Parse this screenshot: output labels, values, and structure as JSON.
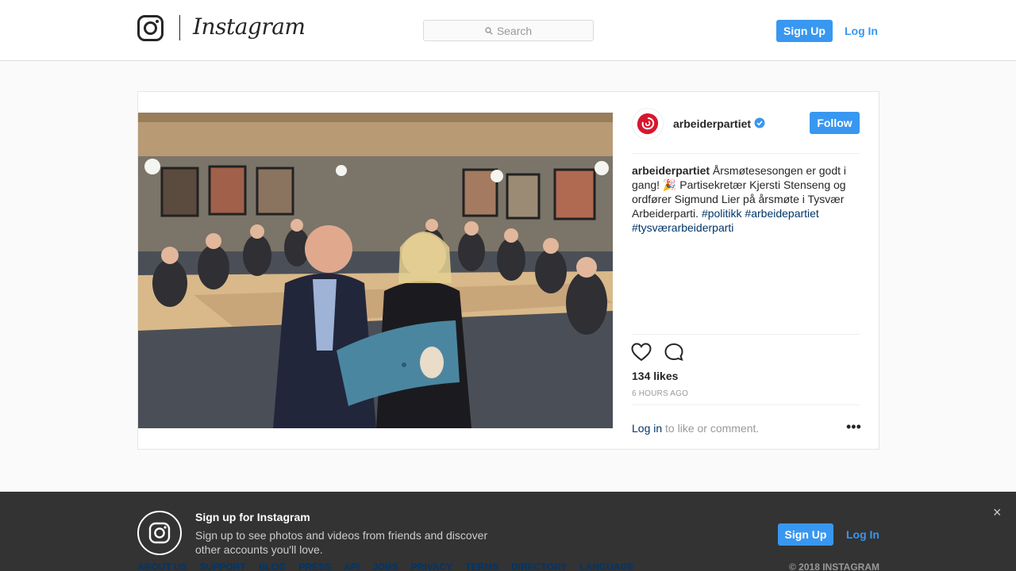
{
  "header": {
    "brand": "Instagram",
    "search_placeholder": "Search",
    "signup_label": "Sign Up",
    "login_label": "Log In"
  },
  "post": {
    "username": "arbeiderpartiet",
    "follow_label": "Follow",
    "caption": {
      "username": "arbeiderpartiet",
      "text": " Årsmøtesesongen er godt i gang! 🎉 Partisekretær Kjersti Stenseng og ordfører Sigmund Lier på årsmøte i Tysvær Arbeiderparti. ",
      "tags": [
        "#politikk",
        "#arbeidepartiet",
        "#tysværarbeiderparti"
      ]
    },
    "likes": "134 likes",
    "time": "6 HOURS AGO",
    "login_link": "Log in",
    "login_rest": " to like or comment.",
    "more": "•••"
  },
  "banner": {
    "title": "Sign up for Instagram",
    "text": "Sign up to see photos and videos from friends and discover other accounts you'll love.",
    "signup_label": "Sign Up",
    "login_label": "Log In",
    "close": "×"
  },
  "footer": {
    "links": [
      "ABOUT US",
      "SUPPORT",
      "BLOG",
      "PRESS",
      "API",
      "JOBS",
      "PRIVACY",
      "TERMS",
      "DIRECTORY",
      "LANGUAGE"
    ],
    "copyright": "© 2018 INSTAGRAM"
  },
  "icons": {
    "logo": "instagram-glyph-icon",
    "search": "search-icon",
    "verified": "verified-badge-icon",
    "heart": "heart-icon",
    "comment": "comment-icon",
    "close": "close-icon",
    "avatar": "rose-logo-icon"
  },
  "colors": {
    "accent": "#3897f0",
    "link": "#003569",
    "banner_bg": "#333333",
    "avatar_rose": "#d7172f"
  }
}
